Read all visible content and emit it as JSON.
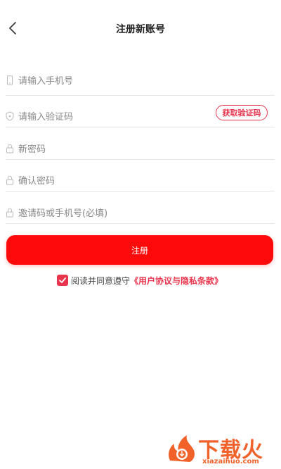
{
  "header": {
    "title": "注册新账号",
    "back_icon": "chevron-left-icon"
  },
  "form": {
    "phone": {
      "placeholder": "请输入手机号",
      "icon": "phone-icon"
    },
    "code": {
      "placeholder": "请输入验证码",
      "icon": "shield-icon",
      "get_code_label": "获取验证码"
    },
    "password": {
      "placeholder": "新密码",
      "icon": "lock-icon"
    },
    "confirm_password": {
      "placeholder": "确认密码",
      "icon": "lock-icon"
    },
    "invite": {
      "placeholder": "邀请码或手机号(必填)",
      "icon": "lock-icon"
    }
  },
  "submit": {
    "label": "注册"
  },
  "agreement": {
    "checked": true,
    "text": "阅读并同意遵守",
    "link": "《用户协议与隐私条款》"
  },
  "watermark": {
    "text_cn": "下载火",
    "text_en": "xiazaihuo.com"
  },
  "colors": {
    "accent": "#e8344c",
    "button": "#ff0a0a",
    "watermark": "#f0622a"
  }
}
